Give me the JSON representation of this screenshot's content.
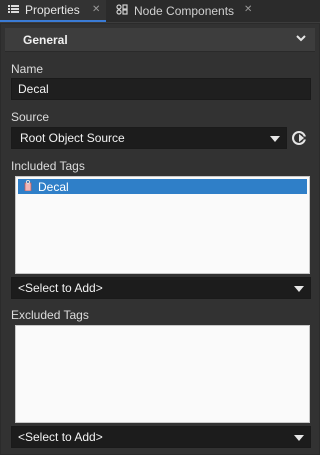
{
  "tabs": [
    {
      "label": "Properties",
      "icon": "list-icon",
      "active": true
    },
    {
      "label": "Node Components",
      "icon": "components-icon",
      "active": false
    }
  ],
  "group": {
    "title": "General"
  },
  "name": {
    "label": "Name",
    "value": "Decal"
  },
  "source": {
    "label": "Source",
    "value": "Root Object Source"
  },
  "included_tags": {
    "label": "Included Tags",
    "items": [
      "Decal"
    ],
    "add_label": "<Select to Add>"
  },
  "excluded_tags": {
    "label": "Excluded Tags",
    "items": [],
    "add_label": "<Select to Add>"
  },
  "colors": {
    "accent": "#2f7fc8",
    "panel": "#323232",
    "field": "#1f1f1f"
  }
}
